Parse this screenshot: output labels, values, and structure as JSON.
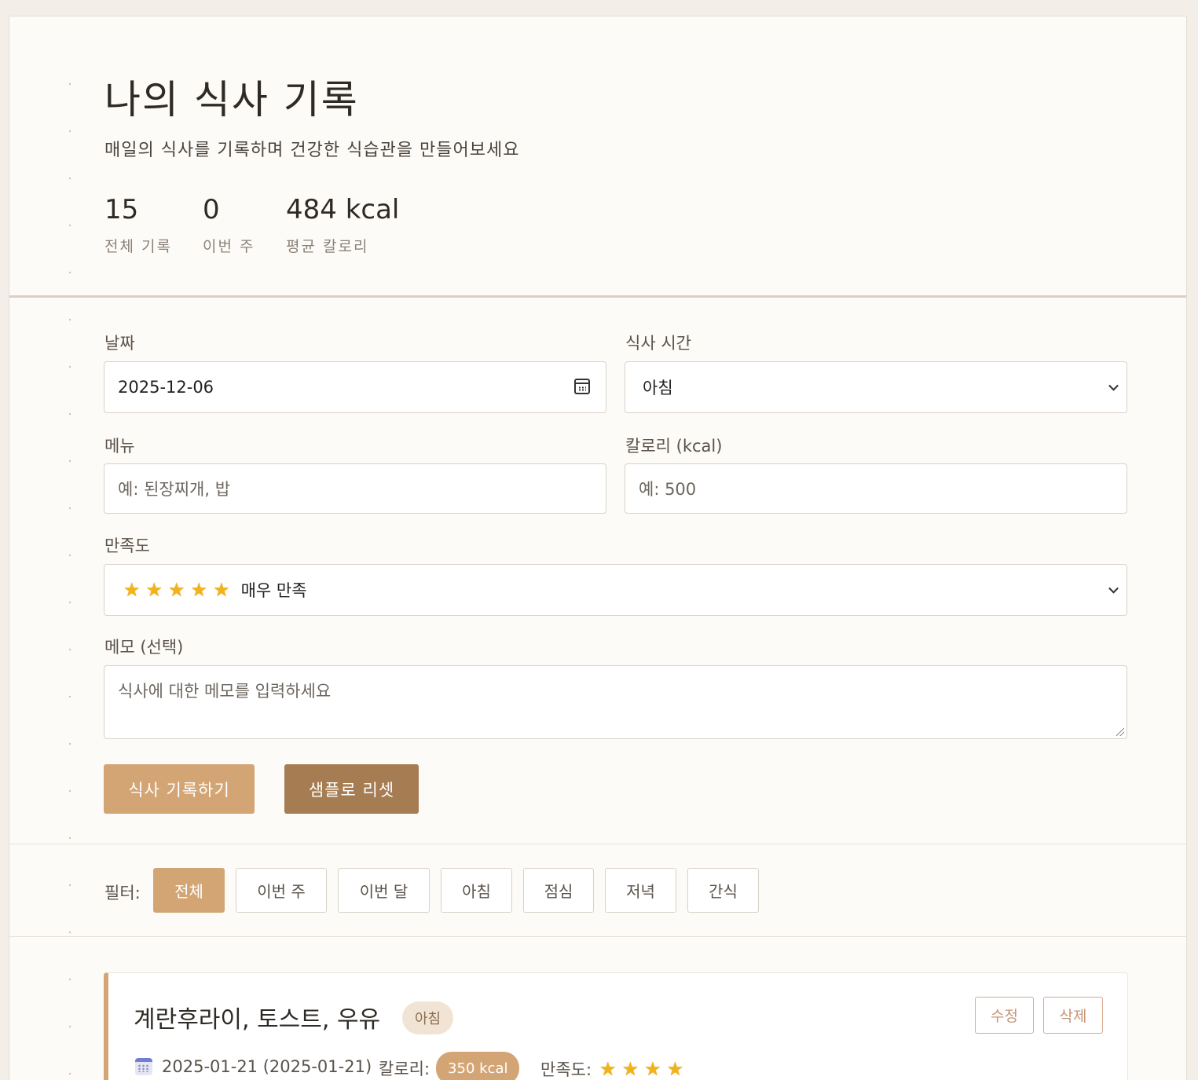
{
  "header": {
    "title": "나의 식사 기록",
    "subtitle": "매일의 식사를 기록하며 건강한 식습관을 만들어보세요",
    "stats": [
      {
        "value": "15",
        "label": "전체 기록"
      },
      {
        "value": "0",
        "label": "이번 주"
      },
      {
        "value": "484 kcal",
        "label": "평균 칼로리"
      }
    ]
  },
  "form": {
    "date_label": "날짜",
    "date_value": "2025-12-06",
    "meal_time_label": "식사 시간",
    "meal_time_value": "아침",
    "menu_label": "메뉴",
    "menu_placeholder": "예: 된장찌개, 밥",
    "calories_label": "칼로리 (kcal)",
    "calories_placeholder": "예: 500",
    "satisfaction_label": "만족도",
    "satisfaction_value": "매우 만족",
    "satisfaction_stars": 5,
    "memo_label": "메모 (선택)",
    "memo_placeholder": "식사에 대한 메모를 입력하세요",
    "submit_label": "식사 기록하기",
    "reset_label": "샘플로 리셋"
  },
  "filter": {
    "label": "필터:",
    "options": [
      "전체",
      "이번 주",
      "이번 달",
      "아침",
      "점심",
      "저녁",
      "간식"
    ],
    "active": "전체"
  },
  "entries": [
    {
      "title": "계란후라이, 토스트, 우유",
      "meal": "아침",
      "date": "2025-01-21 (2025-01-21)",
      "calories_label": "칼로리:",
      "calories": "350 kcal",
      "satisfaction_label": "만족도:",
      "satisfaction_stars": 4,
      "edit_label": "수정",
      "delete_label": "삭제"
    }
  ],
  "colors": {
    "accent": "#d4a574",
    "accent_dark": "#a67c52",
    "background": "#f3eee7",
    "card": "#fdfbf7"
  },
  "icons": {
    "date_picker": "calendar-icon",
    "select": "chevron-down-icon",
    "star": "star-icon",
    "entry_date": "calendar-icon"
  }
}
